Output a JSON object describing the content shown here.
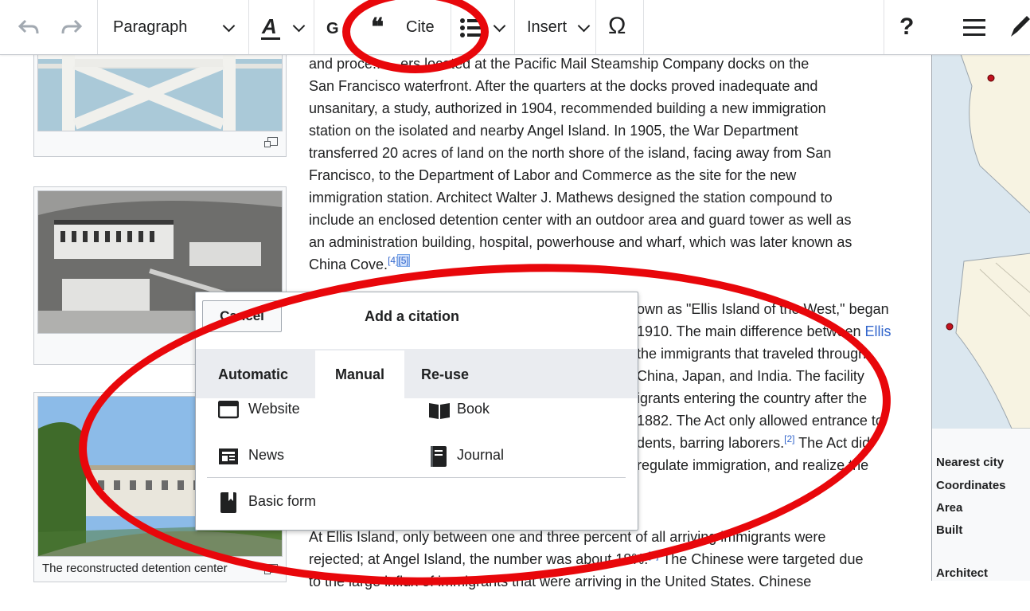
{
  "toolbar": {
    "paragraph": "Paragraph",
    "cite": "Cite",
    "insert": "Insert",
    "omega": "Ω",
    "help": "?"
  },
  "article": {
    "para1": [
      "and proce... ...ers located at the Pacific Mail Steamship Company docks on the",
      "San Francisco waterfront. After the quarters at the docks proved inadequate and",
      "unsanitary, a study, authorized in 1904, recommended building a new immigration",
      "station on the isolated and nearby Angel Island. In 1905, the War Department",
      "transferred 20 acres of land on the north shore of the island, facing away from San",
      "Francisco, to the Department of Labor and Commerce as the site for the new",
      "immigration station.  Architect Walter J. Mathews designed the station compound to",
      "include an enclosed detention center with an outdoor area and guard tower as well as",
      "an administration building, hospital, powerhouse and wharf, which was later known as"
    ],
    "para1_last": "China Cove.",
    "ref4": "[4]",
    "ref5": "[5]",
    "para2": [
      "own as \"Ellis Island of the West,\" began",
      "1910.  The main difference between ",
      "the immigrants that traveled through",
      "China, Japan, and India. The facility",
      "igrants entering the country after the",
      "1882. The Act only allowed entrance to",
      "dents, barring laborers.",
      "regulate immigration, and realize the"
    ],
    "ellis_link": "Ellis",
    "ref2": "[2]",
    "para2_after_ref": " The Act did",
    "para3_line1": "At Ellis Island, only between one and three percent of all arriving immigrants were",
    "para3_line2": "rejected; at Angel Island, the number was about 18%.",
    "ref6": "[6]",
    "para3_line2_after": " The Chinese were targeted due",
    "para3_line3": "to the large influx of immigrants that were arriving in the United States. Chinese"
  },
  "thumbnails": {
    "caption3": "The reconstructed detention center"
  },
  "infobox": {
    "labels": [
      "Nearest city",
      "Coordinates",
      "Area",
      "Built",
      "Architect"
    ]
  },
  "dialog": {
    "cancel": "Cancel",
    "title": "Add a citation",
    "tabs": [
      "Automatic",
      "Manual",
      "Re-use"
    ],
    "options": {
      "website": "Website",
      "book": "Book",
      "news": "News",
      "journal": "Journal",
      "basic": "Basic form"
    }
  },
  "colors": {
    "annotation_red": "#e8070b",
    "link_blue": "#3366cc"
  }
}
